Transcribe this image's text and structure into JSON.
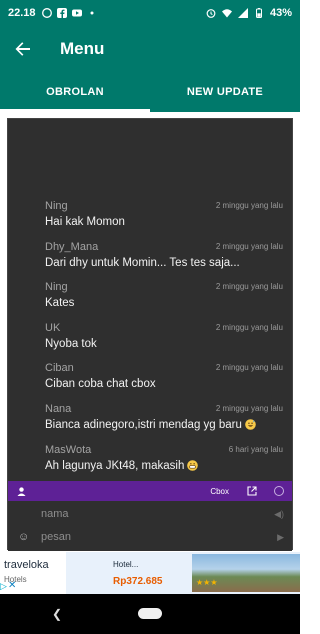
{
  "status_bar": {
    "time": "22.18",
    "battery": "43%"
  },
  "app_bar": {
    "title": "Menu"
  },
  "tabs": [
    {
      "label": "OBROLAN",
      "active": true
    },
    {
      "label": "NEW UPDATE",
      "active": false
    }
  ],
  "chat": {
    "messages": [
      {
        "nick": "Ning",
        "time": "2 minggu yang lalu",
        "text": "Hai kak Momon"
      },
      {
        "nick": "Dhy_Mana",
        "time": "2 minggu yang lalu",
        "text": "Dari dhy untuk Momin... Tes tes saja..."
      },
      {
        "nick": "Ning",
        "time": "2 minggu yang lalu",
        "text": "Kates"
      },
      {
        "nick": "UK",
        "time": "2 minggu yang lalu",
        "text": "Nyoba tok"
      },
      {
        "nick": "Ciban",
        "time": "2 minggu yang lalu",
        "text": "Ciban coba chat cbox"
      },
      {
        "nick": "Nana",
        "time": "2 minggu yang lalu",
        "text": "Bianca adinegoro,istri mendag yg baru",
        "emoji": "sweat-smile-icon"
      },
      {
        "nick": "MasWota",
        "time": "6 hari yang lalu",
        "text": "Ah lagunya JKt48, makasih",
        "emoji": "grin-icon"
      }
    ],
    "toolbar": {
      "brand": "Cbox"
    },
    "name_placeholder": "nama",
    "message_placeholder": "pesan"
  },
  "ad": {
    "brand": "traveloka",
    "sub": "Hotels",
    "headline": "Hotel...",
    "price": "Rp372.685"
  },
  "colors": {
    "primary": "#00796b",
    "chat_bg": "#2f2f2f",
    "cbox_bar": "#5e2196"
  }
}
